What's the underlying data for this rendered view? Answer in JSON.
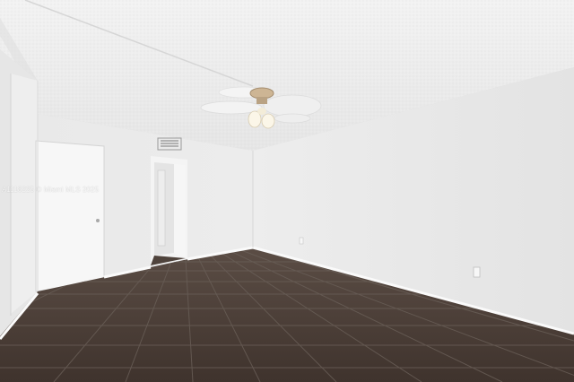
{
  "photo": {
    "subject": "empty-room-interior",
    "watermark": "A1118225 © Miami MLS 2025"
  },
  "colors": {
    "ceiling": "#ececec",
    "wall_light": "#f1f1f1",
    "wall_shade": "#e4e4e4",
    "floor": "#4a3d36",
    "grout": "#6d625b",
    "baseboard": "#fafafa",
    "door": "#f7f7f7"
  },
  "icons": {
    "ceiling_fan": "ceiling-fan-icon",
    "vent": "air-vent-icon",
    "outlet": "power-outlet-icon"
  }
}
